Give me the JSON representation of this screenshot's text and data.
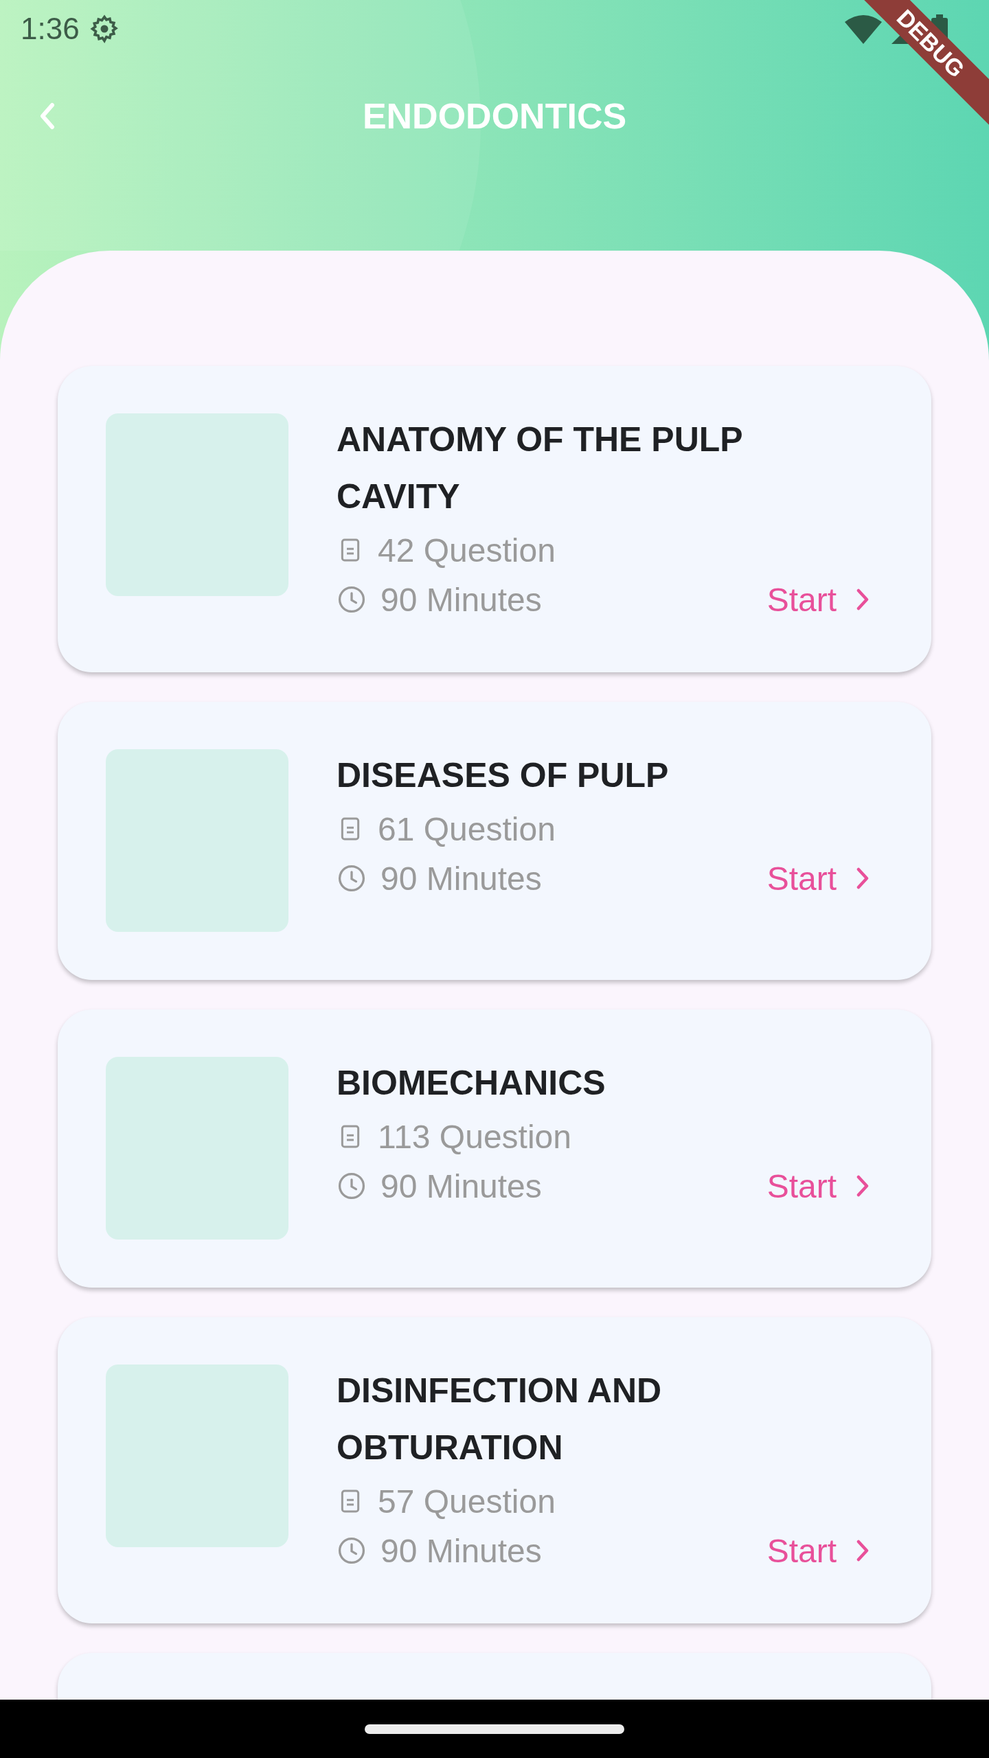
{
  "status_bar": {
    "time": "1:36"
  },
  "debug_banner": "DEBUG",
  "header": {
    "title": "ENDODONTICS"
  },
  "quizzes": [
    {
      "title": "ANATOMY OF THE PULP CAVITY",
      "questions": "42 Question",
      "duration": "90 Minutes",
      "action": "Start"
    },
    {
      "title": "DISEASES OF PULP",
      "questions": "61 Question",
      "duration": "90 Minutes",
      "action": "Start"
    },
    {
      "title": "BIOMECHANICS",
      "questions": "113 Question",
      "duration": "90 Minutes",
      "action": "Start"
    },
    {
      "title": "DISINFECTION AND OBTURATION",
      "questions": "57 Question",
      "duration": "90 Minutes",
      "action": "Start"
    }
  ]
}
